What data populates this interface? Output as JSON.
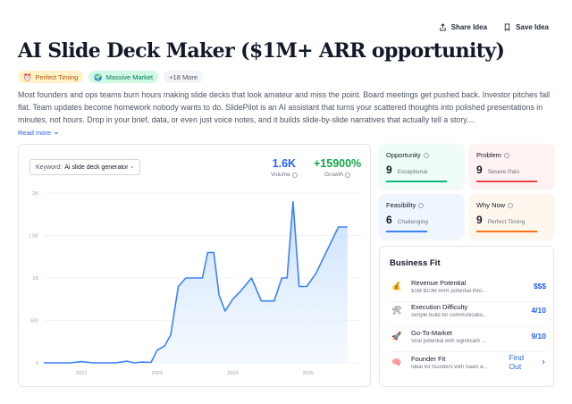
{
  "actions": {
    "share": "Share Idea",
    "save": "Save Idea"
  },
  "title": "AI Slide Deck Maker ($1M+ ARR opportunity)",
  "badges": {
    "timing": {
      "label": "Perfect Timing",
      "icon": "alarm-clock-icon"
    },
    "market": {
      "label": "Massive Market",
      "icon": "globe-icon"
    },
    "more": {
      "label": "+18 More"
    }
  },
  "description": "Most founders and ops teams burn hours making slide decks that look amateur and miss the point. Board meetings get pushed back. Investor pitches fall flat. Team updates become homework nobody wants to do. SlidePilot is an AI assistant that turns your scattered thoughts into polished presentations in minutes, not hours. Drop in your brief, data, or even just voice notes, and it builds slide-by-slide narratives that actually tell a story....",
  "read_more": "Read more",
  "keyword": {
    "label": "Keyword:",
    "value": "Ai slide deck generator"
  },
  "metrics": {
    "volume": {
      "value": "1.6K",
      "label": "Volume"
    },
    "growth": {
      "value": "+15900%",
      "label": "Growth"
    }
  },
  "chart_data": {
    "type": "area",
    "title": "",
    "xlabel": "",
    "ylabel": "",
    "x_ticks": [
      "2022",
      "2023",
      "2024",
      "2025"
    ],
    "y_ticks": [
      "0",
      "500",
      "1K",
      "1.5K",
      "2K"
    ],
    "ylim": [
      0,
      2000
    ],
    "xlim": [
      2021.5,
      2025.7
    ],
    "grid": true,
    "color": "#3b82f6",
    "points": [
      [
        2021.5,
        0
      ],
      [
        2021.85,
        0
      ],
      [
        2022.0,
        15
      ],
      [
        2022.15,
        0
      ],
      [
        2022.45,
        0
      ],
      [
        2022.6,
        20
      ],
      [
        2022.7,
        0
      ],
      [
        2022.8,
        10
      ],
      [
        2022.92,
        5
      ],
      [
        2023.0,
        150
      ],
      [
        2023.1,
        200
      ],
      [
        2023.18,
        330
      ],
      [
        2023.28,
        900
      ],
      [
        2023.38,
        1000
      ],
      [
        2023.5,
        1000
      ],
      [
        2023.6,
        1000
      ],
      [
        2023.67,
        1300
      ],
      [
        2023.75,
        1300
      ],
      [
        2023.82,
        800
      ],
      [
        2023.9,
        610
      ],
      [
        2024.0,
        750
      ],
      [
        2024.1,
        840
      ],
      [
        2024.25,
        1000
      ],
      [
        2024.38,
        730
      ],
      [
        2024.55,
        730
      ],
      [
        2024.65,
        1000
      ],
      [
        2024.72,
        1000
      ],
      [
        2024.8,
        1900
      ],
      [
        2024.88,
        900
      ],
      [
        2024.98,
        900
      ],
      [
        2025.1,
        1050
      ],
      [
        2025.4,
        1600
      ],
      [
        2025.52,
        1600
      ]
    ]
  },
  "tiles": {
    "opportunity": {
      "label": "Opportunity",
      "score": "9",
      "sub": "Exceptional",
      "level": 0.9
    },
    "problem": {
      "label": "Problem",
      "score": "9",
      "sub": "Severe Pain",
      "level": 0.9
    },
    "feasibility": {
      "label": "Feasibility",
      "score": "6",
      "sub": "Challenging",
      "level": 0.6
    },
    "why_now": {
      "label": "Why Now",
      "score": "9",
      "sub": "Perfect Timing",
      "level": 0.9
    }
  },
  "business_fit": {
    "title": "Business Fit",
    "rows": [
      {
        "icon": "money-bag-icon",
        "title": "Revenue Potential",
        "sub": "$1M-$10M ARR potential thro...",
        "value": "$$$"
      },
      {
        "icon": "tools-icon",
        "title": "Execution Difficulty",
        "sub": "Simple build for communicatio...",
        "value": "4/10"
      },
      {
        "icon": "rocket-icon",
        "title": "Go-To-Market",
        "sub": "Viral potential with significant ...",
        "value": "9/10"
      },
      {
        "icon": "brain-icon",
        "title": "Founder Fit",
        "sub": "Ideal for founders with SaaS a...",
        "value": "Find Out"
      }
    ]
  }
}
